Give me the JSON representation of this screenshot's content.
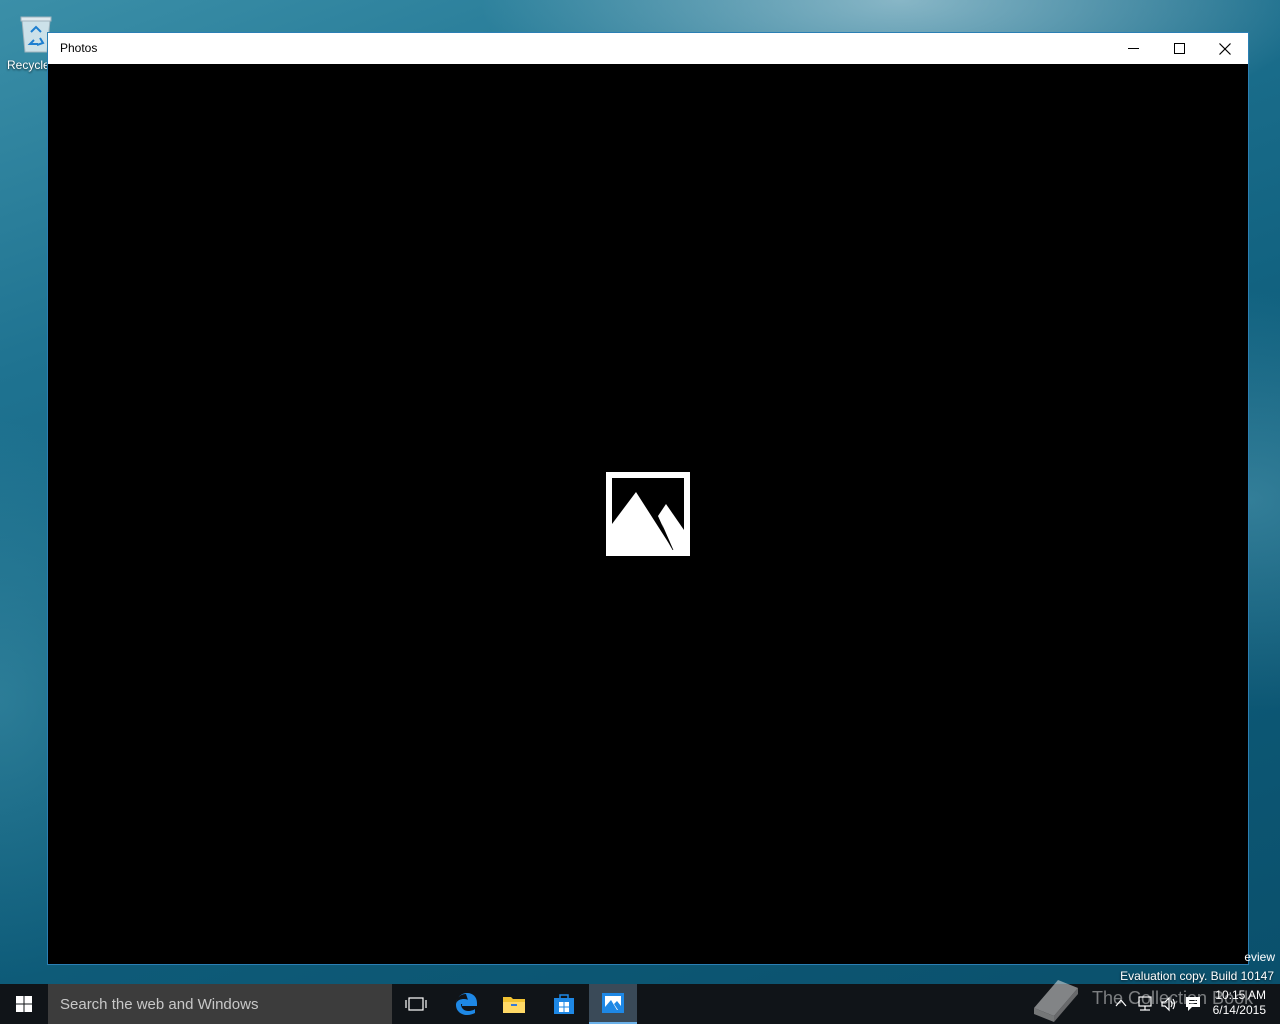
{
  "desktop": {
    "recycle_bin_label": "Recycle"
  },
  "window": {
    "title": "Photos"
  },
  "watermark": {
    "preview_text": "eview",
    "eval_text": "Evaluation copy. Build 10147",
    "brand_text": "The Collection Book"
  },
  "taskbar": {
    "search_placeholder": "Search the web and Windows",
    "apps": [
      "task-view",
      "edge",
      "file-explorer",
      "store",
      "photos"
    ]
  },
  "clock": {
    "time": "10:15 AM",
    "date": "6/14/2015"
  },
  "colors": {
    "accent": "#2b7fb4",
    "taskbar": "#101418",
    "search_bg": "#3c3c3c",
    "content_bg": "#000000"
  }
}
